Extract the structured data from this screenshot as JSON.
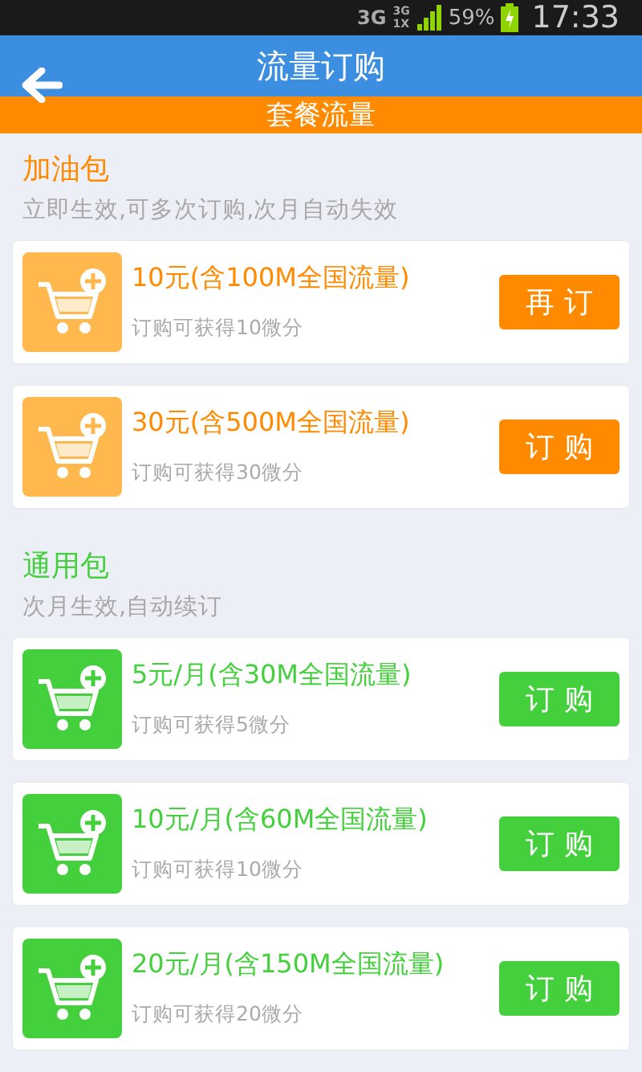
{
  "status_bar": {
    "network": "3G",
    "signal_labels": [
      "3G",
      "1X"
    ],
    "battery": "59%",
    "time": "17:33"
  },
  "header": {
    "title": "流量订购"
  },
  "band": {
    "title": "套餐流量"
  },
  "sections": [
    {
      "kind": "fuel",
      "title": "加油包",
      "subtitle": "立即生效,可多次订购,次月自动失效",
      "items": [
        {
          "name": "10元(含100M全国流量)",
          "reward": "订购可获得10微分",
          "button": "再 订"
        },
        {
          "name": "30元(含500M全国流量)",
          "reward": "订购可获得30微分",
          "button": "订 购"
        }
      ]
    },
    {
      "kind": "general",
      "title": "通用包",
      "subtitle": "次月生效,自动续订",
      "items": [
        {
          "name": "5元/月(含30M全国流量)",
          "reward": "订购可获得5微分",
          "button": "订 购"
        },
        {
          "name": "10元/月(含60M全国流量)",
          "reward": "订购可获得10微分",
          "button": "订 购"
        },
        {
          "name": "20元/月(含150M全国流量)",
          "reward": "订购可获得20微分",
          "button": "订 购"
        }
      ]
    }
  ]
}
